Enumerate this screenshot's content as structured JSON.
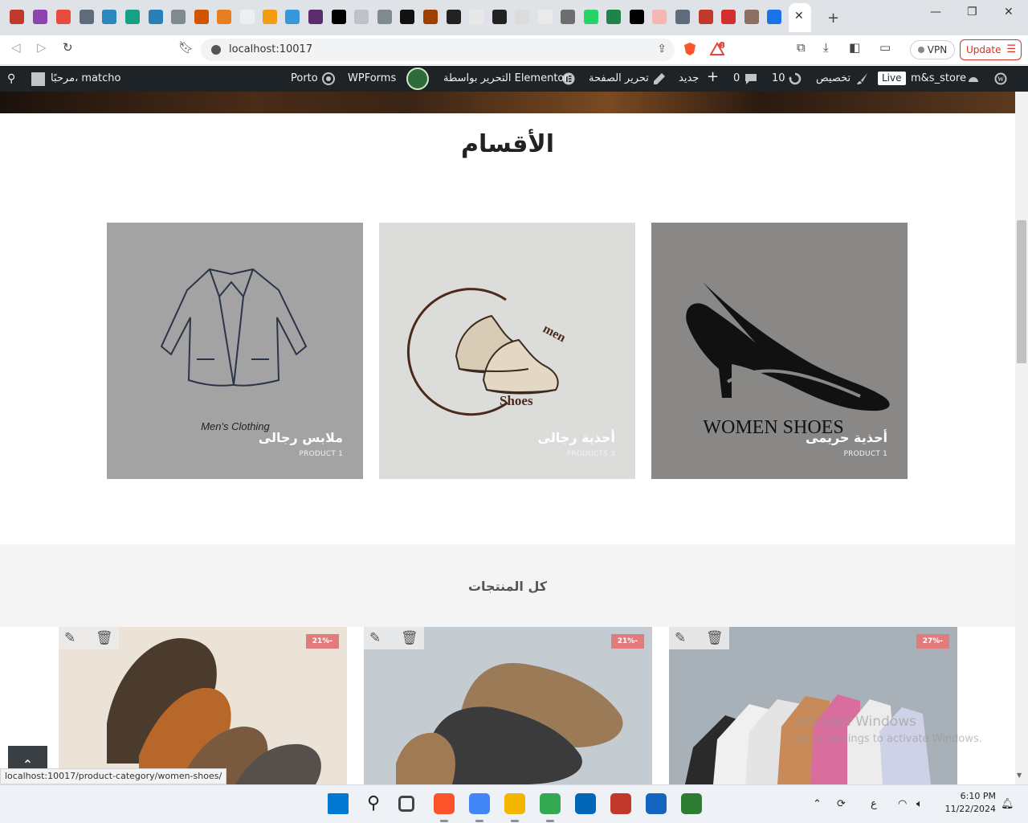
{
  "browser": {
    "new_tab_symbol": "+",
    "close_tab_symbol": "✕",
    "window_controls": [
      "—",
      "❐",
      "✕"
    ],
    "tab_favicon_colors": [
      "#c0392b",
      "#8e44ad",
      "#e74c3c",
      "#5d6d7e",
      "#2e86c1",
      "#16a085",
      "#2980b9",
      "#7f8c8d",
      "#d35400",
      "#e67e22",
      "#ecf0f1",
      "#f39c12",
      "#3498db",
      "#5b2c6f",
      "#000000",
      "#bdc3c7",
      "#7f8c8d",
      "#111111",
      "#a04000",
      "#222222",
      "#e8e8e8",
      "#222222",
      "#dcdcdc",
      "#eaeaea",
      "#6e6e6e",
      "#25d366",
      "#1e8449",
      "#000000",
      "#f5b7b1",
      "#5d6d7e",
      "#c0392b",
      "#d32f2f",
      "#8d6e63",
      "#1a73e8",
      "#2874a6"
    ],
    "url": "localhost:10017",
    "vpn_label": "VPN",
    "update_label": "Update",
    "brave_notification_count": "1"
  },
  "adminbar": {
    "site_name": "m&s_store",
    "live_badge": "Live",
    "customize": "تخصيص",
    "updates_count": "10",
    "comments_count": "0",
    "new_label": "جديد",
    "edit_page": "تحرير الصفحة",
    "edit_elementor": "التحرير بواسطة Elementor",
    "wpforms": "WPForms",
    "porto": "Porto",
    "greeting": "مرحبًا، matcho",
    "accent": "#1d2327"
  },
  "page": {
    "categories_title": "الأقسام",
    "categories": [
      {
        "name": "أحذية حريمى",
        "count": "PRODUCT 1",
        "art_text": "WOMEN SHOES",
        "bg": "#898887"
      },
      {
        "name": "أحذية رجالى",
        "count": "PRODUCTS 3",
        "art_text": "Shoes",
        "art_text2": "men",
        "bg": "#dcdcdb"
      },
      {
        "name": "ملابس رجالى",
        "count": "PRODUCT 1",
        "art_text": "Men's Clothing",
        "bg": "#a3a3a3"
      }
    ],
    "products_title": "كل المنتجات",
    "products": [
      {
        "badge": "-27%",
        "theme": "colorful-slip-ons"
      },
      {
        "badge": "-21%",
        "theme": "suede-loafers"
      },
      {
        "badge": "-21%",
        "theme": "leather-slip-ons"
      }
    ],
    "scroll_top_symbol": "⌃",
    "status_url": "localhost:10017/product-category/women-shoes/",
    "watermark_line1": "Activate Windows",
    "watermark_line2": "Go to Settings to activate Windows."
  },
  "taskbar": {
    "lang": "ع",
    "time": "6:10 PM",
    "date": "11/22/2024",
    "app_colors": [
      "#0078d4",
      "#222222",
      "#444444",
      "#fb542b",
      "#4285f4",
      "#f4b400",
      "#34a853",
      "#0066b8",
      "#c0392b",
      "#1565c0",
      "#2e7d32"
    ]
  }
}
